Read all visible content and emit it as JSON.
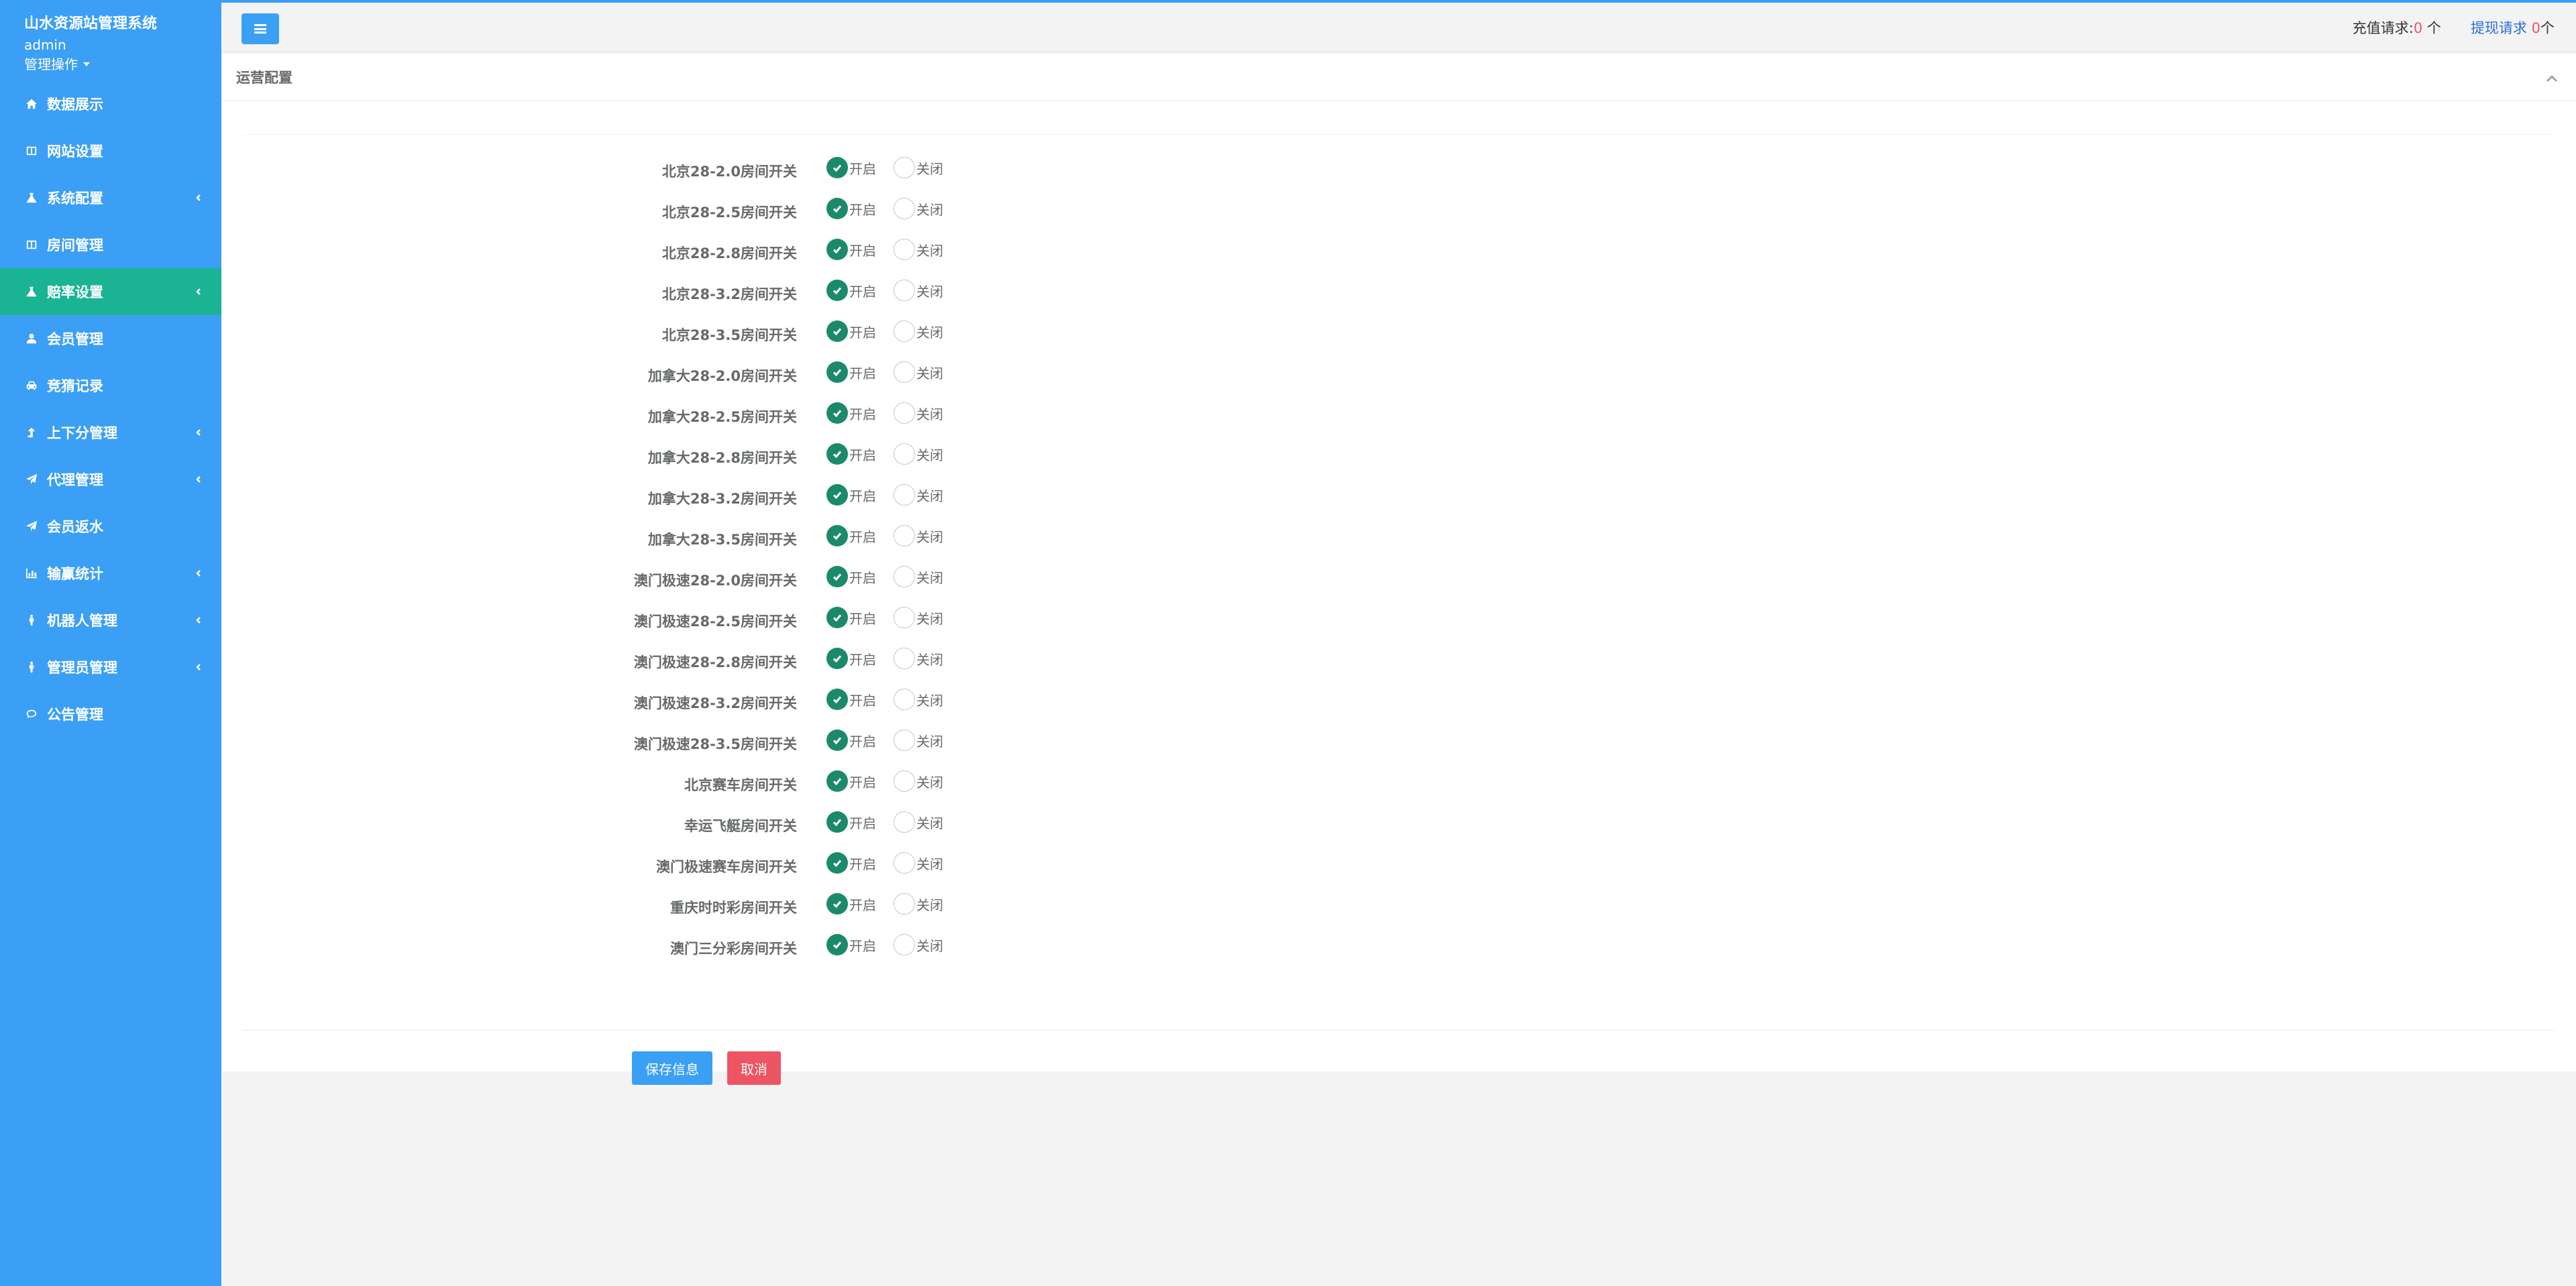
{
  "sidebar": {
    "title": "山水资源站管理系统",
    "user": "admin",
    "ops_label": "管理操作",
    "items": [
      {
        "label": "数据展示",
        "icon": "home-icon",
        "has_arrow": false,
        "active": false
      },
      {
        "label": "网站设置",
        "icon": "columns-icon",
        "has_arrow": false,
        "active": false
      },
      {
        "label": "系统配置",
        "icon": "flask-icon",
        "has_arrow": true,
        "active": false
      },
      {
        "label": "房间管理",
        "icon": "columns-icon",
        "has_arrow": false,
        "active": false
      },
      {
        "label": "赔率设置",
        "icon": "flask-icon",
        "has_arrow": true,
        "active": true
      },
      {
        "label": "会员管理",
        "icon": "user-icon",
        "has_arrow": false,
        "active": false
      },
      {
        "label": "竞猜记录",
        "icon": "car-icon",
        "has_arrow": false,
        "active": false
      },
      {
        "label": "上下分管理",
        "icon": "level-up-icon",
        "has_arrow": true,
        "active": false
      },
      {
        "label": "代理管理",
        "icon": "paper-plane-icon",
        "has_arrow": true,
        "active": false
      },
      {
        "label": "会员返水",
        "icon": "paper-plane-icon",
        "has_arrow": false,
        "active": false
      },
      {
        "label": "输赢统计",
        "icon": "bar-chart-icon",
        "has_arrow": true,
        "active": false
      },
      {
        "label": "机器人管理",
        "icon": "male-icon",
        "has_arrow": true,
        "active": false
      },
      {
        "label": "管理员管理",
        "icon": "male-icon",
        "has_arrow": true,
        "active": false
      },
      {
        "label": "公告管理",
        "icon": "comment-icon",
        "has_arrow": false,
        "active": false
      }
    ]
  },
  "topbar": {
    "recharge_label": "充值请求:",
    "recharge_count": "0",
    "recharge_unit": " 个",
    "withdraw_label": "提现请求 ",
    "withdraw_count": "0",
    "withdraw_unit": "个"
  },
  "panel": {
    "title": "运营配置",
    "on_label": "开启",
    "off_label": "关闭",
    "rows": [
      {
        "label": "北京28-2.0房间开关",
        "value": "on"
      },
      {
        "label": "北京28-2.5房间开关",
        "value": "on"
      },
      {
        "label": "北京28-2.8房间开关",
        "value": "on"
      },
      {
        "label": "北京28-3.2房间开关",
        "value": "on"
      },
      {
        "label": "北京28-3.5房间开关",
        "value": "on"
      },
      {
        "label": "加拿大28-2.0房间开关",
        "value": "on"
      },
      {
        "label": "加拿大28-2.5房间开关",
        "value": "on"
      },
      {
        "label": "加拿大28-2.8房间开关",
        "value": "on"
      },
      {
        "label": "加拿大28-3.2房间开关",
        "value": "on"
      },
      {
        "label": "加拿大28-3.5房间开关",
        "value": "on"
      },
      {
        "label": "澳门极速28-2.0房间开关",
        "value": "on"
      },
      {
        "label": "澳门极速28-2.5房间开关",
        "value": "on"
      },
      {
        "label": "澳门极速28-2.8房间开关",
        "value": "on"
      },
      {
        "label": "澳门极速28-3.2房间开关",
        "value": "on"
      },
      {
        "label": "澳门极速28-3.5房间开关",
        "value": "on"
      },
      {
        "label": "北京赛车房间开关",
        "value": "on"
      },
      {
        "label": "幸运飞艇房间开关",
        "value": "on"
      },
      {
        "label": "澳门极速赛车房间开关",
        "value": "on"
      },
      {
        "label": "重庆时时彩房间开关",
        "value": "on"
      },
      {
        "label": "澳门三分彩房间开关",
        "value": "on"
      }
    ],
    "save_label": "保存信息",
    "cancel_label": "取消"
  },
  "colors": {
    "sidebar_bg": "#3a9ff5",
    "active_item": "#1ab394",
    "radio_checked": "#1b8a6b",
    "danger": "#ed5565",
    "link": "#2e6dd3"
  }
}
